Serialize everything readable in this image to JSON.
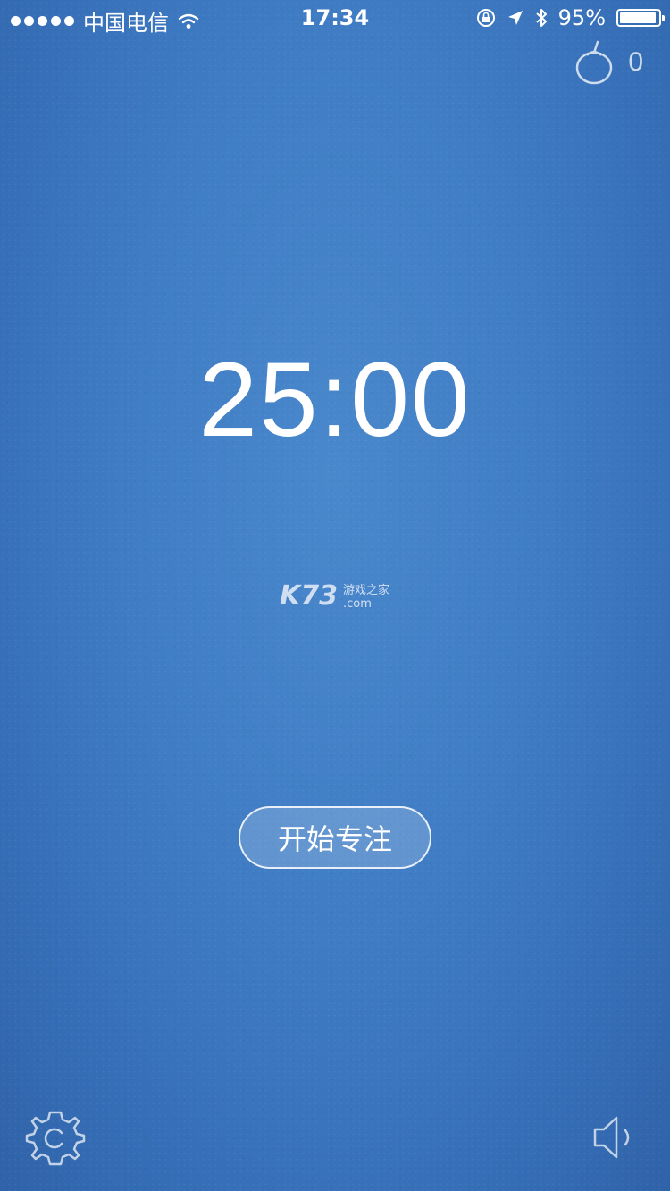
{
  "status_bar": {
    "carrier": "中国电信",
    "time": "17:34",
    "battery_percent": "95%"
  },
  "header": {
    "tomato_icon": "tomato-icon",
    "tomato_count": "0"
  },
  "timer": {
    "display": "25:00"
  },
  "watermark": {
    "logo": "K73",
    "line1": "游戏之家",
    "line2": ".com"
  },
  "actions": {
    "start_label": "开始专注"
  },
  "footer": {
    "settings_icon": "gear-icon",
    "sound_icon": "speaker-icon"
  }
}
